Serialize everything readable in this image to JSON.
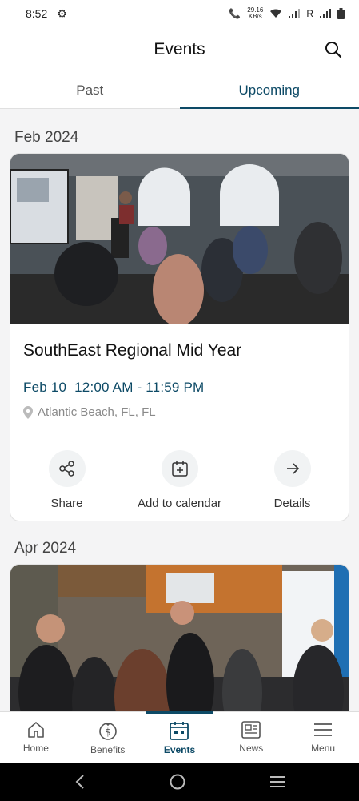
{
  "status_bar": {
    "time": "8:52",
    "speed_top": "29.16",
    "speed_bottom": "KB/s",
    "roaming": "R"
  },
  "header": {
    "title": "Events"
  },
  "tabs": [
    {
      "label": "Past",
      "active": false
    },
    {
      "label": "Upcoming",
      "active": true
    }
  ],
  "sections": [
    {
      "month": "Feb 2024",
      "event": {
        "title": "SouthEast Regional Mid Year",
        "date": "Feb 10",
        "time_range": "12:00 AM - 11:59 PM",
        "location": "Atlantic Beach, FL, FL"
      }
    },
    {
      "month": "Apr 2024"
    }
  ],
  "card_actions": {
    "share": "Share",
    "add_to_calendar": "Add to calendar",
    "details": "Details"
  },
  "bottom_nav": [
    {
      "label": "Home",
      "icon": "home-icon"
    },
    {
      "label": "Benefits",
      "icon": "dollar-icon"
    },
    {
      "label": "Events",
      "icon": "calendar-icon",
      "active": true
    },
    {
      "label": "News",
      "icon": "newspaper-icon"
    },
    {
      "label": "Menu",
      "icon": "hamburger-icon"
    }
  ],
  "colors": {
    "accent": "#0d4a66",
    "background": "#f4f4f5"
  }
}
